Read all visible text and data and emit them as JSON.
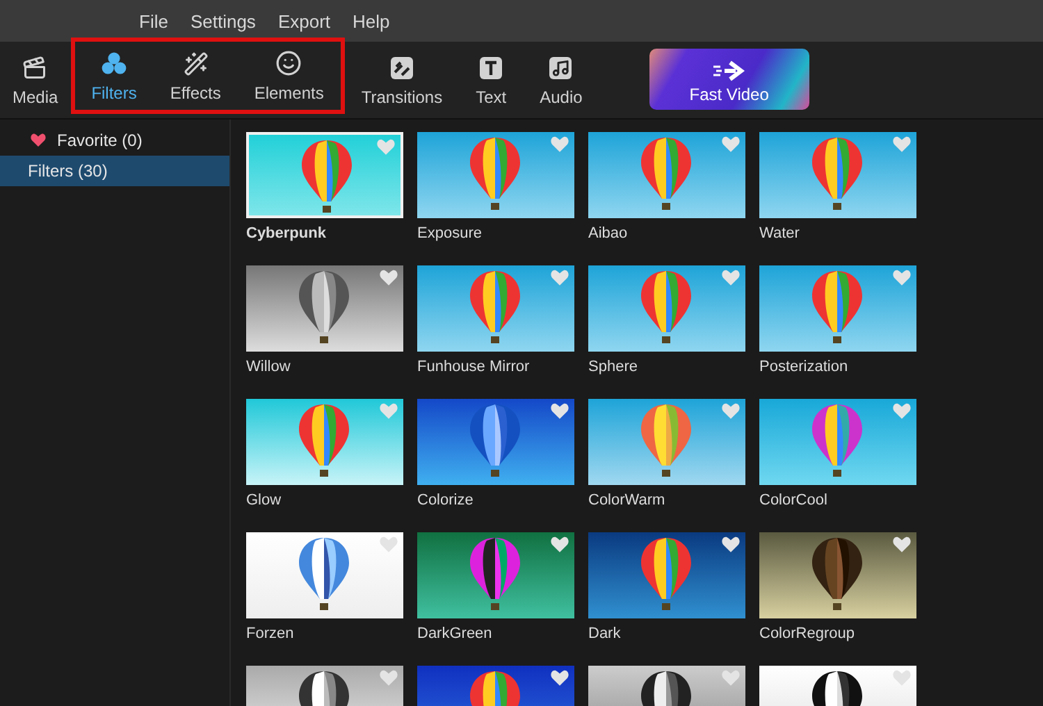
{
  "menu": [
    "File",
    "Settings",
    "Export",
    "Help"
  ],
  "toolbar": {
    "tools": [
      {
        "label": "Media",
        "kind": "media",
        "selected": false,
        "highlighted": false
      },
      {
        "label": "Filters",
        "kind": "filters",
        "selected": true,
        "highlighted": true
      },
      {
        "label": "Effects",
        "kind": "effects",
        "selected": false,
        "highlighted": true
      },
      {
        "label": "Elements",
        "kind": "elements",
        "selected": false,
        "highlighted": true
      },
      {
        "label": "Transitions",
        "kind": "transitions",
        "selected": false,
        "highlighted": false
      },
      {
        "label": "Text",
        "kind": "text",
        "selected": false,
        "highlighted": false
      },
      {
        "label": "Audio",
        "kind": "audio",
        "selected": false,
        "highlighted": false
      }
    ],
    "promo": {
      "label": "Fast Video"
    }
  },
  "sidebar": {
    "items": [
      {
        "label": "Favorite (0)",
        "kind": "favorite",
        "selected": false
      },
      {
        "label": "Filters (30)",
        "kind": "plain",
        "selected": true
      }
    ]
  },
  "filters": [
    {
      "name": "Cyberpunk",
      "selected": true,
      "favorite": false
    },
    {
      "name": "Exposure",
      "selected": false,
      "favorite": false
    },
    {
      "name": "Aibao",
      "selected": false,
      "favorite": false
    },
    {
      "name": "Water",
      "selected": false,
      "favorite": false
    },
    {
      "name": "Willow",
      "selected": false,
      "favorite": false
    },
    {
      "name": "Funhouse Mirror",
      "selected": false,
      "favorite": false
    },
    {
      "name": "Sphere",
      "selected": false,
      "favorite": false
    },
    {
      "name": "Posterization",
      "selected": false,
      "favorite": false
    },
    {
      "name": "Glow",
      "selected": false,
      "favorite": false
    },
    {
      "name": "Colorize",
      "selected": false,
      "favorite": false
    },
    {
      "name": "ColorWarm",
      "selected": false,
      "favorite": false
    },
    {
      "name": "ColorCool",
      "selected": false,
      "favorite": false
    },
    {
      "name": "Forzen",
      "selected": false,
      "favorite": false
    },
    {
      "name": "DarkGreen",
      "selected": false,
      "favorite": false
    },
    {
      "name": "Dark",
      "selected": false,
      "favorite": false
    },
    {
      "name": "ColorRegroup",
      "selected": false,
      "favorite": false
    },
    {
      "selected": false,
      "favorite": false
    },
    {
      "selected": false,
      "favorite": false
    },
    {
      "selected": false,
      "favorite": false
    },
    {
      "selected": false,
      "favorite": false
    }
  ]
}
